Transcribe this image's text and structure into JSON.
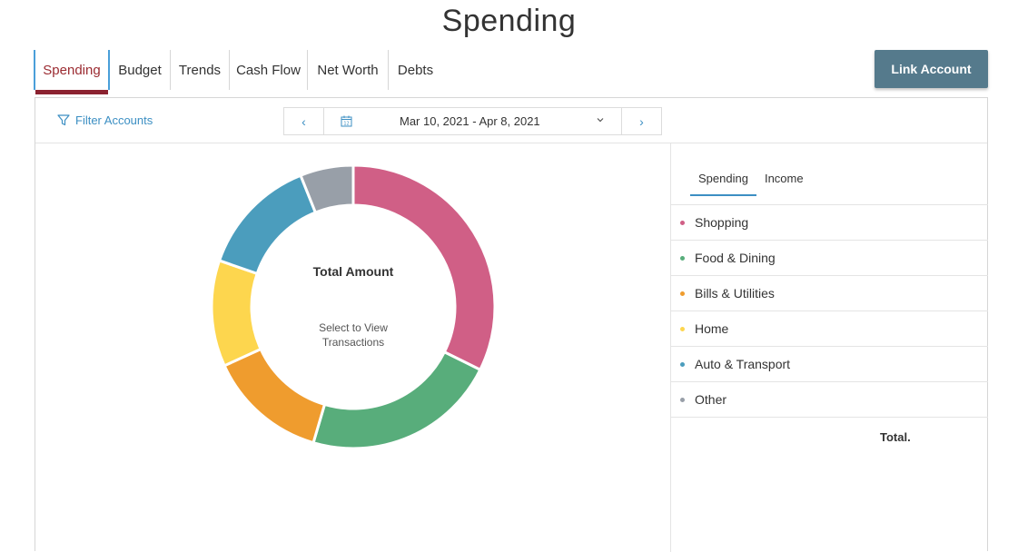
{
  "page": {
    "title": "Spending"
  },
  "tabs": [
    {
      "label": "Spending",
      "active": true
    },
    {
      "label": "Budget"
    },
    {
      "label": "Trends"
    },
    {
      "label": "Cash Flow"
    },
    {
      "label": "Net Worth"
    },
    {
      "label": "Debts"
    }
  ],
  "link_account_label": "Link Account",
  "toolbar": {
    "filter_label": "Filter Accounts",
    "date_range": "Mar 10, 2021 - Apr 8, 2021",
    "prev_icon": "chevron-left-icon",
    "next_icon": "chevron-right-icon",
    "calendar_icon": "calendar-icon",
    "dropdown_icon": "chevron-down-icon",
    "filter_icon": "filter-icon"
  },
  "chart": {
    "center_title": "Total Amount",
    "center_sub_line1": "Select to View",
    "center_sub_line2": "Transactions"
  },
  "chart_data": {
    "type": "pie",
    "donut": true,
    "categories": [
      "Shopping",
      "Food & Dining",
      "Bills & Utilities",
      "Home",
      "Auto & Transport",
      "Other"
    ],
    "values": [
      32.0,
      22.0,
      13.5,
      12.0,
      13.5,
      6.0
    ],
    "colors": [
      "#d05f86",
      "#58ad7b",
      "#ef9c2e",
      "#fdd64e",
      "#4b9dbd",
      "#989fa8"
    ]
  },
  "legend": {
    "subtabs": [
      "Spending",
      "Income"
    ],
    "items": [
      {
        "label": "Shopping",
        "color": "#d05f86"
      },
      {
        "label": "Food & Dining",
        "color": "#58ad7b"
      },
      {
        "label": "Bills & Utilities",
        "color": "#ef9c2e"
      },
      {
        "label": "Home",
        "color": "#fdd64e"
      },
      {
        "label": "Auto & Transport",
        "color": "#4b9dbd"
      },
      {
        "label": "Other",
        "color": "#989fa8"
      }
    ],
    "total_label": "Total."
  }
}
